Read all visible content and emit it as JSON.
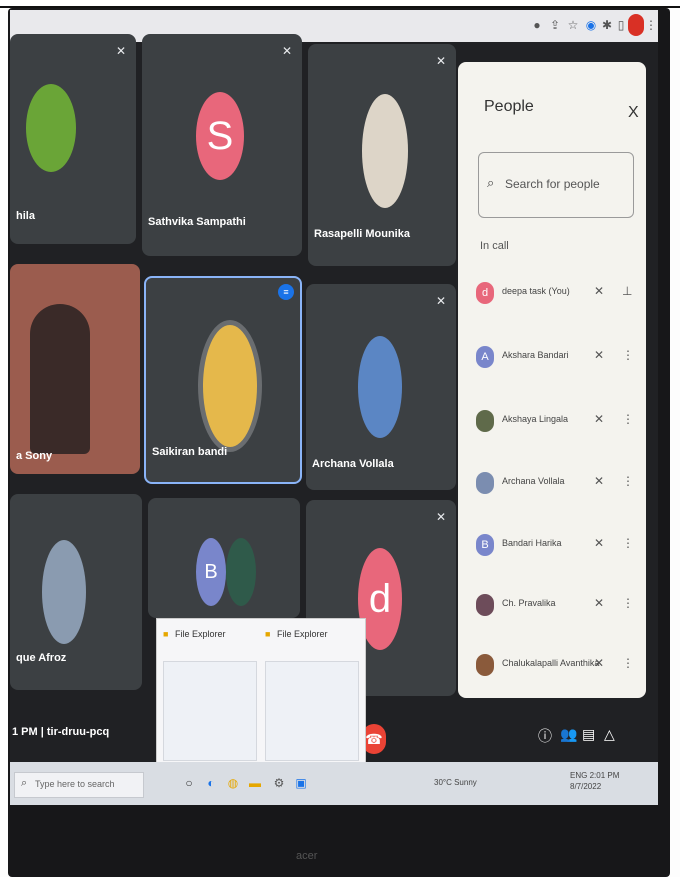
{
  "meet": {
    "code": "tir-druu-pcq",
    "time_fragment": "1 PM",
    "tiles": [
      {
        "name": "hila",
        "type": "photo",
        "muted": true
      },
      {
        "name": "Sathvika Sampathi",
        "letter": "S",
        "color": "#e8677b",
        "muted": true
      },
      {
        "name": "Rasapelli Mounika",
        "type": "photo",
        "muted": true
      },
      {
        "name": "a Sony",
        "type": "video",
        "muted": false
      },
      {
        "name": "Saikiran bandi",
        "type": "photo",
        "muted": false,
        "speaking": true
      },
      {
        "name": "Archana Vollala",
        "type": "photo",
        "muted": true
      },
      {
        "name": "que Afroz",
        "type": "photo",
        "muted": false
      },
      {
        "name": "",
        "letter": "B",
        "color": "#7986cb",
        "muted": false
      },
      {
        "name": "",
        "letter": "d",
        "color": "#e8677b",
        "muted": true
      }
    ]
  },
  "people_panel": {
    "title": "People",
    "close": "X",
    "search_placeholder": "Search for people",
    "section": "In call",
    "participants": [
      {
        "name": "deepa task (You)",
        "letter": "d",
        "color": "#e8677b"
      },
      {
        "name": "Akshara Bandari",
        "letter": "A",
        "color": "#7986cb"
      },
      {
        "name": "Akshaya Lingala",
        "letter": "",
        "color": "#5f6a4a"
      },
      {
        "name": "Archana Vollala",
        "letter": "",
        "color": "#7b8db0"
      },
      {
        "name": "Bandari Harika",
        "letter": "B",
        "color": "#7986cb"
      },
      {
        "name": "Ch. Pravalika",
        "letter": "",
        "color": "#6d4c5a"
      },
      {
        "name": "Chalukalapalli Avanthika",
        "letter": "",
        "color": "#8a5a3b"
      }
    ]
  },
  "file_explorer": {
    "title_1": "File Explorer",
    "title_2": "File Explorer"
  },
  "taskbar": {
    "search": "Type here to search",
    "weather": "30°C Sunny",
    "time": "2:01 PM",
    "date": "8/7/2022",
    "lang": "ENG"
  },
  "colors": {
    "accent": "#1a73e8",
    "end_call": "#ea4335",
    "tile_bg": "#3c4043"
  },
  "icons": [
    "mic-off-icon",
    "search-icon",
    "more-vert-icon",
    "pin-icon",
    "end-call-icon",
    "info-icon",
    "people-icon",
    "chat-icon",
    "activities-icon"
  ]
}
